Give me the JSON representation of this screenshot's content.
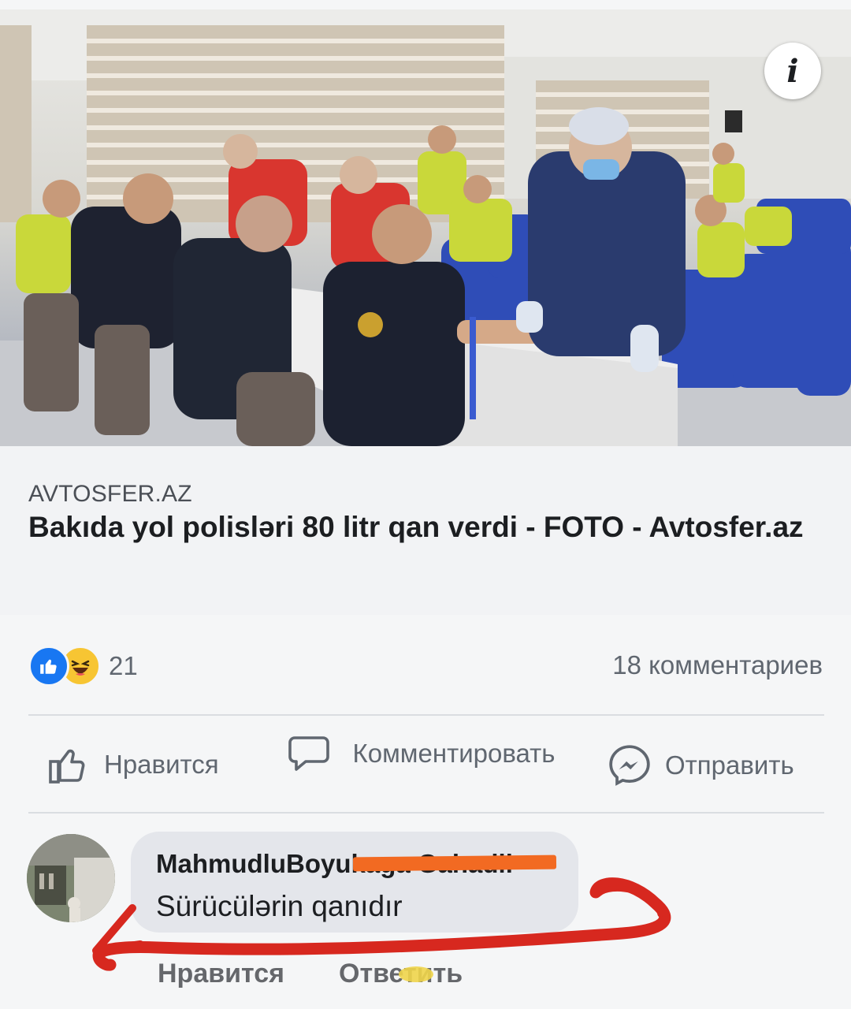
{
  "post": {
    "info_label": "i",
    "link": {
      "source": "AVTOSFER.AZ",
      "title": "Bakıda yol polisləri 80 litr qan verdi - FOTO - Avtosfer.az"
    },
    "reactions": {
      "icons": [
        "like-icon",
        "haha-icon"
      ],
      "count": "21",
      "comments": "18 комментариев"
    },
    "actions": {
      "like": "Нравится",
      "comment": "Комментировать",
      "share": "Отправить"
    },
    "comment": {
      "author": "MahmudluBoyukaga Gahadli",
      "text": "Sürücülərin qanıdır",
      "like": "Нравится",
      "reply": "Ответить"
    }
  },
  "colors": {
    "accent": "#1877f2",
    "redaction": "#f26a22",
    "annotation": "#d7281f"
  }
}
